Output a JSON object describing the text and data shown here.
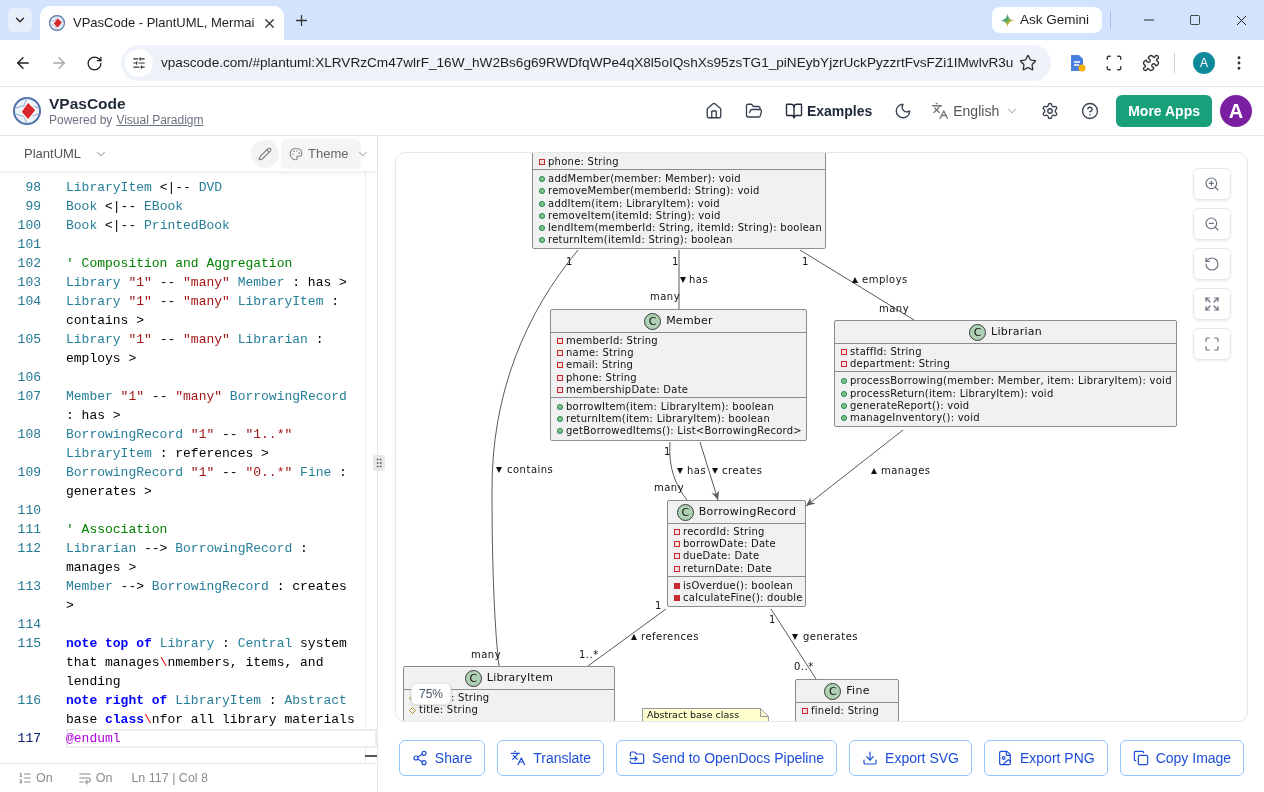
{
  "browser": {
    "tab": {
      "title": "VPasCode - PlantUML, Mermai",
      "selected": true
    },
    "ask_gemini": "Ask Gemini",
    "url": "vpascode.com/#plantuml:XLRVRzCm47wlrF_16W_hW2Bs6g69RWDfqWPe4qX8l5oIQshXs95zsTG1_piNEybYjzrUckPyzzrtFvsFZi1IMwlvR3u",
    "profile": "A"
  },
  "header": {
    "title": "VPasCode",
    "powered_by": "Powered by",
    "powered_by_link": "Visual Paradigm",
    "examples": "Examples",
    "language": "English",
    "more_apps": "More Apps",
    "avatar": "A"
  },
  "editor": {
    "language": "PlantUML",
    "theme": "Theme",
    "lines": [
      {
        "number": "98",
        "current": false,
        "tokens": [
          {
            "kind": "type",
            "text": "LibraryItem"
          },
          {
            "kind": "plain",
            "text": " <|-- "
          },
          {
            "kind": "type",
            "text": "DVD"
          }
        ]
      },
      {
        "number": "99",
        "current": false,
        "tokens": [
          {
            "kind": "type",
            "text": "Book"
          },
          {
            "kind": "plain",
            "text": " <|-- "
          },
          {
            "kind": "type",
            "text": "EBook"
          }
        ]
      },
      {
        "number": "100",
        "current": false,
        "tokens": [
          {
            "kind": "type",
            "text": "Book"
          },
          {
            "kind": "plain",
            "text": " <|-- "
          },
          {
            "kind": "type",
            "text": "PrintedBook"
          }
        ]
      },
      {
        "number": "101",
        "current": false
      },
      {
        "number": "102",
        "current": false,
        "tokens": [
          {
            "kind": "comment",
            "text": "' Composition and Aggregation"
          }
        ]
      },
      {
        "number": "103",
        "current": false,
        "tokens": [
          {
            "kind": "type",
            "text": "Library"
          },
          {
            "kind": "string",
            "text": " \"1\""
          },
          {
            "kind": "plain",
            "text": " -- "
          },
          {
            "kind": "string",
            "text": "\"many\""
          },
          {
            "kind": "type",
            "text": " Member"
          },
          {
            "kind": "plain",
            "text": " : has >"
          }
        ]
      },
      {
        "number": "104",
        "current": false,
        "tokens": [
          {
            "kind": "type",
            "text": "Library"
          },
          {
            "kind": "string",
            "text": " \"1\""
          },
          {
            "kind": "plain",
            "text": " -- "
          },
          {
            "kind": "string",
            "text": "\"many\""
          },
          {
            "kind": "type",
            "text": " LibraryItem"
          },
          {
            "kind": "plain",
            "text": " : contains >"
          }
        ]
      },
      {
        "number": "105",
        "current": false,
        "tokens": [
          {
            "kind": "type",
            "text": "Library"
          },
          {
            "kind": "string",
            "text": " \"1\""
          },
          {
            "kind": "plain",
            "text": " -- "
          },
          {
            "kind": "string",
            "text": "\"many\""
          },
          {
            "kind": "type",
            "text": " Librarian"
          },
          {
            "kind": "plain",
            "text": " : employs >"
          }
        ]
      },
      {
        "number": "106",
        "current": false
      },
      {
        "number": "107",
        "current": false,
        "tokens": [
          {
            "kind": "type",
            "text": "Member"
          },
          {
            "kind": "string",
            "text": " \"1\""
          },
          {
            "kind": "plain",
            "text": " -- "
          },
          {
            "kind": "string",
            "text": "\"many\""
          },
          {
            "kind": "type",
            "text": " BorrowingRecord"
          },
          {
            "kind": "plain",
            "text": " : has >"
          }
        ]
      },
      {
        "number": "108",
        "current": false,
        "tokens": [
          {
            "kind": "type",
            "text": "BorrowingRecord"
          },
          {
            "kind": "string",
            "text": " \"1\""
          },
          {
            "kind": "plain",
            "text": " -- "
          },
          {
            "kind": "string",
            "text": "\"1..*\""
          },
          {
            "kind": "type",
            "text": " LibraryItem"
          },
          {
            "kind": "plain",
            "text": " : references >"
          }
        ]
      },
      {
        "number": "109",
        "current": false,
        "tokens": [
          {
            "kind": "type",
            "text": "BorrowingRecord"
          },
          {
            "kind": "string",
            "text": " \"1\""
          },
          {
            "kind": "plain",
            "text": " -- "
          },
          {
            "kind": "string",
            "text": "\"0..*\""
          },
          {
            "kind": "type",
            "text": " Fine"
          },
          {
            "kind": "plain",
            "text": " : generates >"
          }
        ]
      },
      {
        "number": "110",
        "current": false
      },
      {
        "number": "111",
        "current": false,
        "tokens": [
          {
            "kind": "comment",
            "text": "' Association"
          }
        ]
      },
      {
        "number": "112",
        "current": false,
        "tokens": [
          {
            "kind": "type",
            "text": "Librarian"
          },
          {
            "kind": "plain",
            "text": " --> "
          },
          {
            "kind": "type",
            "text": "BorrowingRecord"
          },
          {
            "kind": "plain",
            "text": " : manages >"
          }
        ]
      },
      {
        "number": "113",
        "current": false,
        "tokens": [
          {
            "kind": "type",
            "text": "Member"
          },
          {
            "kind": "plain",
            "text": " --> "
          },
          {
            "kind": "type",
            "text": "BorrowingRecord"
          },
          {
            "kind": "plain",
            "text": " : creates >"
          }
        ]
      },
      {
        "number": "114",
        "current": false
      },
      {
        "number": "115",
        "current": false,
        "tokens": [
          {
            "kind": "keyword",
            "text": "note top of"
          },
          {
            "kind": "type",
            "text": " Library"
          },
          {
            "kind": "plain",
            "text": " : "
          },
          {
            "kind": "type",
            "text": "Central"
          },
          {
            "kind": "plain",
            "text": " system that manages"
          },
          {
            "kind": "escape",
            "text": "\\"
          },
          {
            "kind": "plain",
            "text": "nmembers, items, and lending"
          }
        ]
      },
      {
        "number": "116",
        "current": false,
        "tokens": [
          {
            "kind": "keyword",
            "text": "note right of"
          },
          {
            "kind": "type",
            "text": " LibraryItem"
          },
          {
            "kind": "plain",
            "text": " : "
          },
          {
            "kind": "type",
            "text": "Abstract"
          },
          {
            "kind": "plain",
            "text": " base "
          },
          {
            "kind": "keyword",
            "text": "class"
          },
          {
            "kind": "escape",
            "text": "\\"
          },
          {
            "kind": "plain",
            "text": "nfor all library materials"
          }
        ]
      },
      {
        "number": "117",
        "current": true,
        "tokens": [
          {
            "kind": "directive",
            "text": "@enduml"
          }
        ]
      }
    ],
    "status": {
      "line_numbers": "On",
      "word_wrap": "On",
      "cursor": "Ln 117 | Col 8"
    }
  },
  "diagram": {
    "zoom": "75%",
    "classes": [
      {
        "attributes": [
          {
            "kind": "private",
            "text": "phone: String"
          }
        ],
        "methods": [
          {
            "kind": "public",
            "text": "addMember(member: Member): void"
          },
          {
            "kind": "public",
            "text": "removeMember(memberId: String): void"
          },
          {
            "kind": "public",
            "text": "addItem(item: LibraryItem): void"
          },
          {
            "kind": "public",
            "text": "removeItem(itemId: String): void"
          },
          {
            "kind": "public",
            "text": "lendItem(memberId: String, itemId: String): boolean"
          },
          {
            "kind": "public",
            "text": "returnItem(itemId: String): boolean"
          }
        ]
      },
      {
        "badge": "C",
        "name": "Member",
        "attributes": [
          {
            "kind": "private",
            "text": "memberId: String"
          },
          {
            "kind": "private",
            "text": "name: String"
          },
          {
            "kind": "private",
            "text": "email: String"
          },
          {
            "kind": "private",
            "text": "phone: String"
          },
          {
            "kind": "private",
            "text": "membershipDate: Date"
          }
        ],
        "methods": [
          {
            "kind": "public",
            "text": "borrowItem(item: LibraryItem): boolean"
          },
          {
            "kind": "public",
            "text": "returnItem(item: LibraryItem): boolean"
          },
          {
            "kind": "public",
            "text": "getBorrowedItems(): List<BorrowingRecord>"
          }
        ]
      },
      {
        "badge": "C",
        "name": "Librarian",
        "attributes": [
          {
            "kind": "private",
            "text": "staffId: String"
          },
          {
            "kind": "private",
            "text": "department: String"
          }
        ],
        "methods": [
          {
            "kind": "public",
            "text": "processBorrowing(member: Member, item: LibraryItem): void"
          },
          {
            "kind": "public",
            "text": "processReturn(item: LibraryItem): void"
          },
          {
            "kind": "public",
            "text": "generateReport(): void"
          },
          {
            "kind": "public",
            "text": "manageInventory(): void"
          }
        ]
      },
      {
        "badge": "C",
        "name": "BorrowingRecord",
        "attributes": [
          {
            "kind": "private",
            "text": "recordId: String"
          },
          {
            "kind": "private",
            "text": "borrowDate: Date"
          },
          {
            "kind": "private",
            "text": "dueDate: Date"
          },
          {
            "kind": "private",
            "text": "returnDate: Date"
          }
        ],
        "methods": [
          {
            "kind": "private",
            "text": "isOverdue(): boolean"
          },
          {
            "kind": "private",
            "text": "calculateFine(): double"
          }
        ]
      },
      {
        "badge": "C",
        "name": "LibraryItem",
        "attributes": [
          {
            "kind": "protected",
            "text": ": String",
            "covered": true
          },
          {
            "kind": "protected",
            "text": "title: String"
          }
        ]
      },
      {
        "badge": "C",
        "name": "Fine",
        "attributes": [
          {
            "kind": "private",
            "text": "fineId: String"
          }
        ]
      }
    ],
    "edges": [
      {
        "kind": "association",
        "label": "contains",
        "label_marker": {
          "kind": "down"
        },
        "source_multiplicity": "1",
        "target_multiplicity": "many"
      },
      {
        "kind": "association",
        "label": "has",
        "label_marker": {
          "kind": "down"
        },
        "source_multiplicity": "1",
        "target_multiplicity": "many"
      },
      {
        "kind": "association",
        "label": "employs",
        "label_marker": {
          "kind": "up"
        },
        "source_multiplicity": "1",
        "target_multiplicity": "many"
      },
      {
        "kind": "association",
        "label": "has",
        "label_marker": {
          "kind": "down"
        },
        "source_multiplicity": "1",
        "target_multiplicity": "many"
      },
      {
        "kind": "directed",
        "label": "creates",
        "label_marker": {
          "kind": "down"
        }
      },
      {
        "kind": "directed",
        "label": "manages",
        "label_marker": {
          "kind": "up"
        }
      },
      {
        "kind": "association",
        "label": "references",
        "label_marker": {
          "kind": "up"
        },
        "source_multiplicity": "1",
        "target_multiplicity": "1..*"
      },
      {
        "kind": "association",
        "label": "generates",
        "label_marker": {
          "kind": "down"
        },
        "source_multiplicity": "1",
        "target_multiplicity": "0..*"
      }
    ],
    "note": "Abstract base class"
  },
  "actions": [
    "Share",
    "Translate",
    "Send to OpenDocs Pipeline",
    "Export SVG",
    "Export PNG",
    "Copy Image"
  ]
}
